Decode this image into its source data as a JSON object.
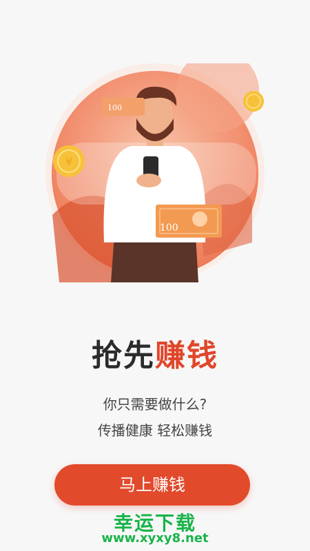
{
  "hero": {
    "icon": "person-holding-phone-money-illustration",
    "bill_label_small": "100",
    "bill_label_large": "100"
  },
  "headline": {
    "part1": "抢先",
    "part2": "赚钱"
  },
  "subtitle": {
    "line1": "你只需要做什么?",
    "line2": "传播健康 轻松赚钱"
  },
  "cta": {
    "label": "马上赚钱"
  },
  "watermark": {
    "name": "幸运下载",
    "url": "www.xyxy8.net"
  },
  "colors": {
    "accent": "#e24a2c",
    "watermark": "#19b34a",
    "title": "#2b2b2b"
  }
}
